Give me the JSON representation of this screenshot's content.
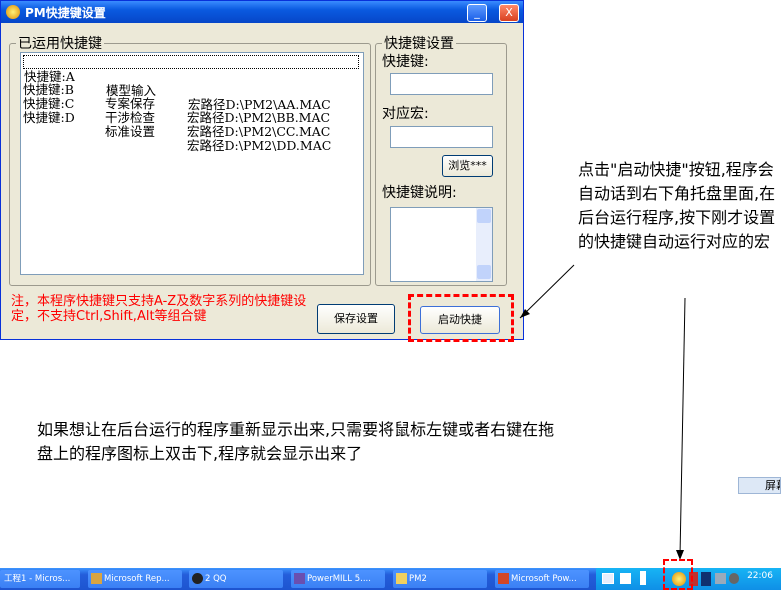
{
  "window": {
    "title": "PM快捷键设置",
    "min_label": "_",
    "close_label": "X"
  },
  "used_hotkeys": {
    "legend": "已运用快捷键",
    "items": [
      {
        "key": "快捷键:A",
        "name": "模型输入",
        "path": "宏路径D:\\PM2\\AA.MAC"
      },
      {
        "key": "快捷键:B",
        "name": "专案保存",
        "path": "宏路径D:\\PM2\\BB.MAC"
      },
      {
        "key": "快捷键:C",
        "name": "干涉检查",
        "path": "宏路径D:\\PM2\\CC.MAC"
      },
      {
        "key": "快捷键:D",
        "name": "标准设置",
        "path": "宏路径D:\\PM2\\DD.MAC"
      }
    ]
  },
  "settings": {
    "legend": "快捷键设置",
    "hotkey_label": "快捷键:",
    "hotkey_value": "",
    "macro_label": "对应宏:",
    "macro_value": "",
    "browse_label": "浏览***",
    "desc_label": "快捷键说明:",
    "desc_value": ""
  },
  "note": "注，本程序快捷键只支持A-Z及数字系列的快捷键设定，不支持Ctrl,Shift,Alt等组合键",
  "buttons": {
    "save": "保存设置",
    "start": "启动快捷"
  },
  "annotations": {
    "right": "点击\"启动快捷\"按钮,程序会自动话到右下角托盘里面,在后台运行程序,按下刚才设置的快捷键自动运行对应的宏",
    "bottom": "如果想让在后台运行的程序重新显示出来,只需要将鼠标左键或者右键在拖盘上的程序图标上双击下,程序就会显示出来了"
  },
  "partial_window_label": "屏幕",
  "taskbar": {
    "items": [
      {
        "label": "工程1 - Micros..."
      },
      {
        "label": "Microsoft Rep..."
      },
      {
        "label": "2 QQ"
      },
      {
        "label": "PowerMILL 5...."
      },
      {
        "label": "PM2"
      },
      {
        "label": "Microsoft Pow..."
      }
    ],
    "clock": "22:06"
  },
  "colors": {
    "highlight": "#ff0000",
    "titlebar": "#0a5ae0"
  }
}
